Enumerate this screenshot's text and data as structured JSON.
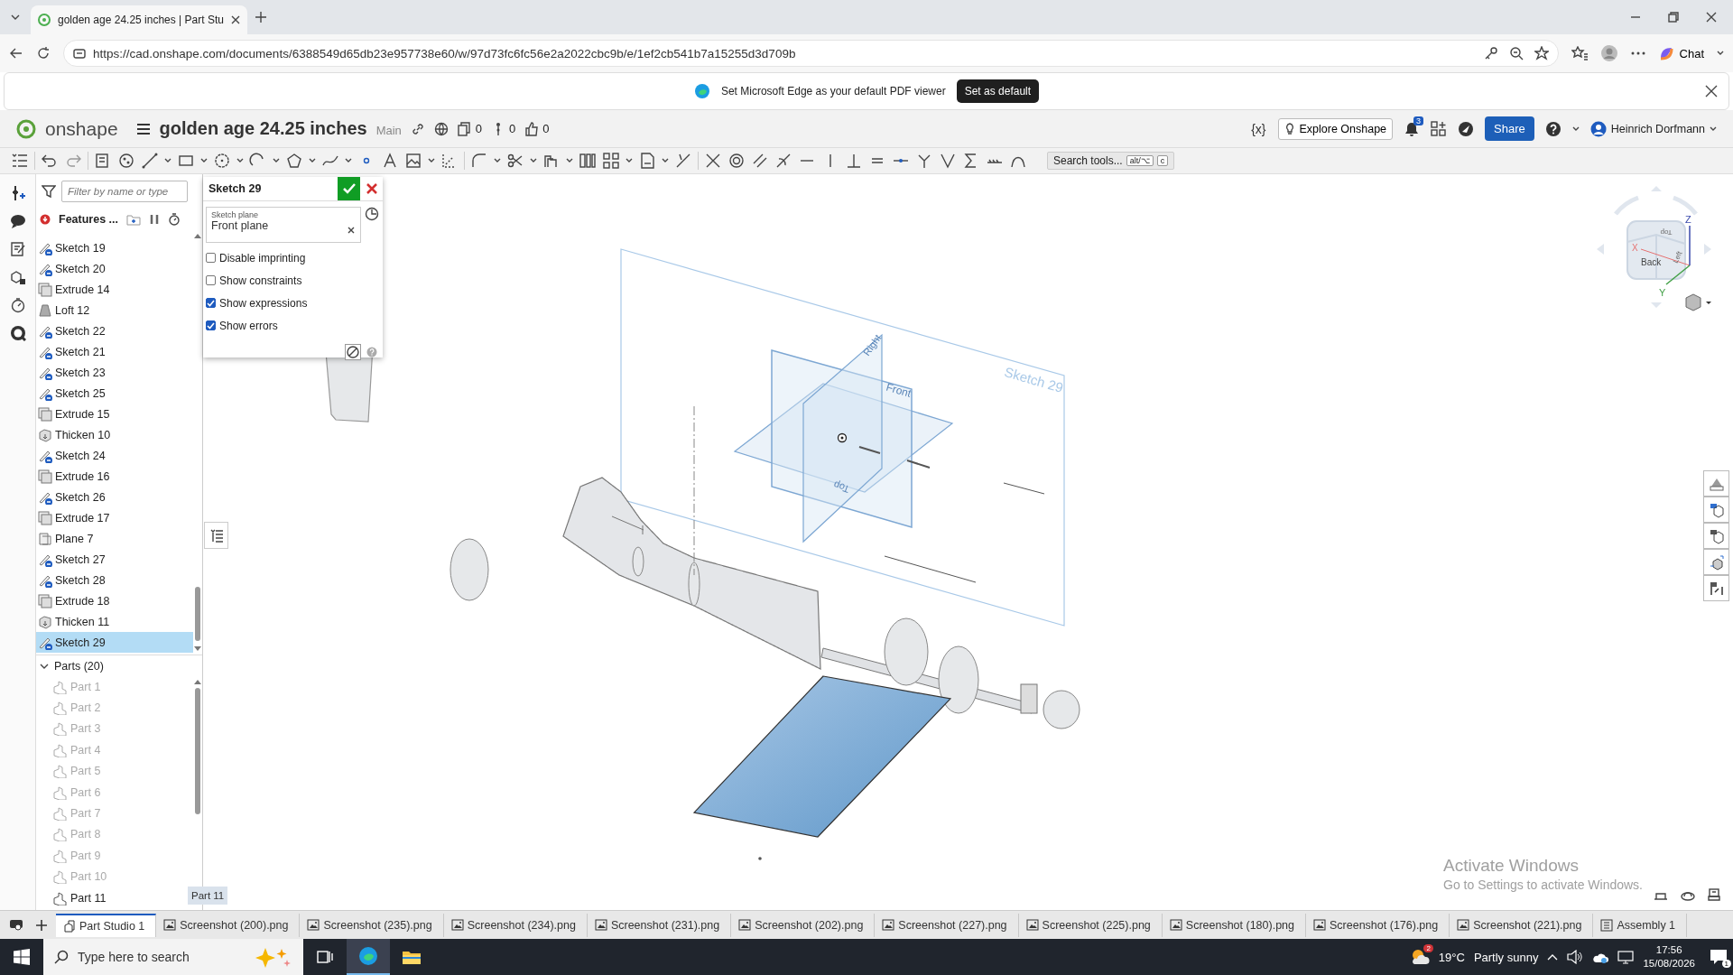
{
  "browser": {
    "tab_title": "golden age 24.25 inches | Part Stu",
    "url": "https://cad.onshape.com/documents/6388549d65db23e957738e60/w/97d73fc6fc56e2a2022cbc9b/e/1ef2cb541b7a15255d3d709b",
    "chat_label": "Chat"
  },
  "infobar": {
    "message": "Set Microsoft Edge as your default PDF viewer",
    "button": "Set as default"
  },
  "header": {
    "app_name": "onshape",
    "document_title": "golden age 24.25 inches",
    "workspace": "Main",
    "counters": [
      {
        "kind": "versions",
        "value": "0"
      },
      {
        "kind": "branches",
        "value": "0"
      },
      {
        "kind": "likes",
        "value": "0"
      }
    ],
    "variables_label": "{x}",
    "explore_button": "Explore Onshape",
    "notification_count": "3",
    "share_button": "Share",
    "user_name": "Heinrich Dorfmann"
  },
  "toolbar": {
    "search_placeholder": "Search tools...",
    "shortcut_keys": [
      "alt/⌥",
      "c"
    ]
  },
  "feature_tree": {
    "filter_placeholder": "Filter by name or type",
    "header_label": "Features ...",
    "features": [
      {
        "name": "Sketch 19",
        "kind": "sketch",
        "selected": false
      },
      {
        "name": "Sketch 20",
        "kind": "sketch",
        "selected": false
      },
      {
        "name": "Extrude 14",
        "kind": "extrude",
        "selected": false
      },
      {
        "name": "Loft 12",
        "kind": "loft",
        "selected": false
      },
      {
        "name": "Sketch 22",
        "kind": "sketch",
        "selected": false
      },
      {
        "name": "Sketch 21",
        "kind": "sketch",
        "selected": false
      },
      {
        "name": "Sketch 23",
        "kind": "sketch",
        "selected": false
      },
      {
        "name": "Sketch 25",
        "kind": "sketch",
        "selected": false
      },
      {
        "name": "Extrude 15",
        "kind": "extrude",
        "selected": false
      },
      {
        "name": "Thicken 10",
        "kind": "thicken",
        "selected": false
      },
      {
        "name": "Sketch 24",
        "kind": "sketch",
        "selected": false
      },
      {
        "name": "Extrude 16",
        "kind": "extrude",
        "selected": false
      },
      {
        "name": "Sketch 26",
        "kind": "sketch",
        "selected": false
      },
      {
        "name": "Extrude 17",
        "kind": "extrude",
        "selected": false
      },
      {
        "name": "Plane 7",
        "kind": "plane",
        "selected": false
      },
      {
        "name": "Sketch 27",
        "kind": "sketch",
        "selected": false
      },
      {
        "name": "Sketch 28",
        "kind": "sketch",
        "selected": false
      },
      {
        "name": "Extrude 18",
        "kind": "extrude",
        "selected": false
      },
      {
        "name": "Thicken 11",
        "kind": "thicken",
        "selected": false
      },
      {
        "name": "Sketch 29",
        "kind": "sketch",
        "selected": true
      }
    ],
    "parts_header": "Parts (20)",
    "parts_expanded": true,
    "parts": [
      {
        "name": "Part 1",
        "hidden": true
      },
      {
        "name": "Part 2",
        "hidden": true
      },
      {
        "name": "Part 3",
        "hidden": true
      },
      {
        "name": "Part 4",
        "hidden": true
      },
      {
        "name": "Part 5",
        "hidden": true
      },
      {
        "name": "Part 6",
        "hidden": true
      },
      {
        "name": "Part 7",
        "hidden": true
      },
      {
        "name": "Part 8",
        "hidden": true
      },
      {
        "name": "Part 9",
        "hidden": true
      },
      {
        "name": "Part 10",
        "hidden": true
      },
      {
        "name": "Part 11",
        "hidden": false
      }
    ]
  },
  "tooltip": "Part 11",
  "sketch_dialog": {
    "title": "Sketch 29",
    "plane_label": "Sketch plane",
    "plane_value": "Front plane",
    "options": [
      {
        "label": "Disable imprinting",
        "checked": false
      },
      {
        "label": "Show constraints",
        "checked": false
      },
      {
        "label": "Show expressions",
        "checked": true
      },
      {
        "label": "Show errors",
        "checked": true
      }
    ]
  },
  "viewport": {
    "sketch_label": "Sketch 29",
    "plane_labels": [
      "Front",
      "Right",
      "Top"
    ],
    "cube_faces": [
      "Top",
      "Back",
      "Left"
    ],
    "axes": [
      "X",
      "Y",
      "Z"
    ]
  },
  "activation": {
    "title": "Activate Windows",
    "subtitle": "Go to Settings to activate Windows."
  },
  "doc_tabs": [
    {
      "label": "Part Studio 1",
      "kind": "partstudio",
      "selected": true
    },
    {
      "label": "Screenshot (200).png",
      "kind": "image",
      "selected": false
    },
    {
      "label": "Screenshot (235).png",
      "kind": "image",
      "selected": false
    },
    {
      "label": "Screenshot (234).png",
      "kind": "image",
      "selected": false
    },
    {
      "label": "Screenshot (231).png",
      "kind": "image",
      "selected": false
    },
    {
      "label": "Screenshot (202).png",
      "kind": "image",
      "selected": false
    },
    {
      "label": "Screenshot (227).png",
      "kind": "image",
      "selected": false
    },
    {
      "label": "Screenshot (225).png",
      "kind": "image",
      "selected": false
    },
    {
      "label": "Screenshot (180).png",
      "kind": "image",
      "selected": false
    },
    {
      "label": "Screenshot (176).png",
      "kind": "image",
      "selected": false
    },
    {
      "label": "Screenshot (221).png",
      "kind": "image",
      "selected": false
    },
    {
      "label": "Assembly 1",
      "kind": "assembly",
      "selected": false
    }
  ],
  "taskbar": {
    "search_placeholder": "Type here to search",
    "weather_badge": "2",
    "temperature": "19°C",
    "weather": "Partly sunny",
    "time": "17:56",
    "date": "15/08/2026",
    "notification_count": "1"
  }
}
